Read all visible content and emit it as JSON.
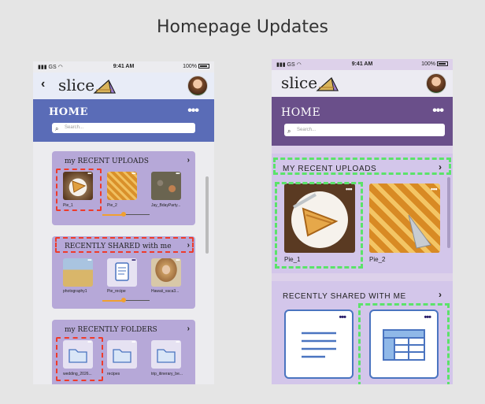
{
  "page": {
    "title": "Homepage Updates"
  },
  "status": {
    "carrier": "GS",
    "time": "9:41 AM",
    "battery": "100%"
  },
  "app": {
    "logo_text": "slice",
    "home_title": "HOME",
    "menu_dots": "•••",
    "search_placeholder": "Search...",
    "thumb_dots": "•••"
  },
  "phone_a": {
    "recent_uploads": {
      "title": "my RECENT UPLOADS",
      "items": [
        {
          "label": "Pie_1"
        },
        {
          "label": "Pie_2"
        },
        {
          "label": "Jay_BdayParty..."
        }
      ],
      "slider_position": 0.55
    },
    "recently_shared": {
      "title": "RECENTLY SHARED with me",
      "items": [
        {
          "label": "photography1"
        },
        {
          "label": "Pie_recipe"
        },
        {
          "label": "Hawaii_vaca3..."
        }
      ],
      "slider_position": 0.55
    },
    "recent_folders": {
      "title": "my RECENTLY FOLDERS",
      "items": [
        {
          "label": "wedding_2026..."
        },
        {
          "label": "recipes"
        },
        {
          "label": "trip_itinerary_be..."
        }
      ]
    }
  },
  "phone_b": {
    "recent_uploads": {
      "title": "MY RECENT UPLOADS",
      "items": [
        {
          "label": "Pie_1"
        },
        {
          "label": "Pie_2"
        }
      ]
    },
    "recently_shared": {
      "title": "RECENTLY SHARED WITH ME"
    }
  },
  "colors": {
    "phone_a_header": "#5a6cb7",
    "phone_b_header": "#6a4f8a",
    "card": "#b6a8d8",
    "red_highlight": "#ee3b2b",
    "green_highlight": "#5be36a",
    "doc_blue": "#4a74c0"
  }
}
